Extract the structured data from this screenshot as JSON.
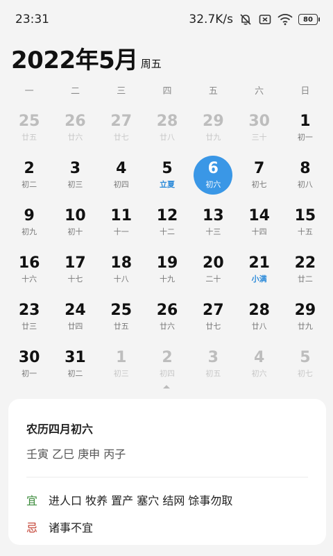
{
  "status_bar": {
    "time": "23:31",
    "network_speed": "32.7K/s",
    "battery_level": "80",
    "icons": [
      "bell-off-icon",
      "sim-off-icon",
      "wifi-icon",
      "battery-icon"
    ]
  },
  "header": {
    "title": "2022年5月",
    "weekday": "周五"
  },
  "weekdays": [
    "一",
    "二",
    "三",
    "四",
    "五",
    "六",
    "日"
  ],
  "calendar": {
    "days": [
      {
        "num": "25",
        "lunar": "廿五",
        "dim": true
      },
      {
        "num": "26",
        "lunar": "廿六",
        "dim": true
      },
      {
        "num": "27",
        "lunar": "廿七",
        "dim": true
      },
      {
        "num": "28",
        "lunar": "廿八",
        "dim": true
      },
      {
        "num": "29",
        "lunar": "廿九",
        "dim": true
      },
      {
        "num": "30",
        "lunar": "三十",
        "dim": true
      },
      {
        "num": "1",
        "lunar": "初一"
      },
      {
        "num": "2",
        "lunar": "初二"
      },
      {
        "num": "3",
        "lunar": "初三"
      },
      {
        "num": "4",
        "lunar": "初四"
      },
      {
        "num": "5",
        "lunar": "立夏",
        "term": true
      },
      {
        "num": "6",
        "lunar": "初六",
        "selected": true
      },
      {
        "num": "7",
        "lunar": "初七"
      },
      {
        "num": "8",
        "lunar": "初八"
      },
      {
        "num": "9",
        "lunar": "初九"
      },
      {
        "num": "10",
        "lunar": "初十"
      },
      {
        "num": "11",
        "lunar": "十一"
      },
      {
        "num": "12",
        "lunar": "十二"
      },
      {
        "num": "13",
        "lunar": "十三"
      },
      {
        "num": "14",
        "lunar": "十四"
      },
      {
        "num": "15",
        "lunar": "十五"
      },
      {
        "num": "16",
        "lunar": "十六"
      },
      {
        "num": "17",
        "lunar": "十七"
      },
      {
        "num": "18",
        "lunar": "十八"
      },
      {
        "num": "19",
        "lunar": "十九"
      },
      {
        "num": "20",
        "lunar": "二十"
      },
      {
        "num": "21",
        "lunar": "小满",
        "term": true
      },
      {
        "num": "22",
        "lunar": "廿二"
      },
      {
        "num": "23",
        "lunar": "廿三"
      },
      {
        "num": "24",
        "lunar": "廿四"
      },
      {
        "num": "25",
        "lunar": "廿五"
      },
      {
        "num": "26",
        "lunar": "廿六"
      },
      {
        "num": "27",
        "lunar": "廿七"
      },
      {
        "num": "28",
        "lunar": "廿八"
      },
      {
        "num": "29",
        "lunar": "廿九"
      },
      {
        "num": "30",
        "lunar": "初一"
      },
      {
        "num": "31",
        "lunar": "初二"
      },
      {
        "num": "1",
        "lunar": "初三",
        "dim": true
      },
      {
        "num": "2",
        "lunar": "初四",
        "dim": true
      },
      {
        "num": "3",
        "lunar": "初五",
        "dim": true
      },
      {
        "num": "4",
        "lunar": "初六",
        "dim": true
      },
      {
        "num": "5",
        "lunar": "初七",
        "dim": true
      }
    ]
  },
  "detail_card": {
    "lunar_date": "农历四月初六",
    "ganzhi": "壬寅 乙巳 庚申 丙子",
    "good_label": "宜",
    "good_text": "进人口 牧养 置产 塞穴 结网 馀事勿取",
    "bad_label": "忌",
    "bad_text": "诸事不宜"
  },
  "colors": {
    "accent": "#3a97e6",
    "solar_term": "#2b8ad9",
    "good": "#3a8a3a",
    "bad": "#c0392b"
  }
}
